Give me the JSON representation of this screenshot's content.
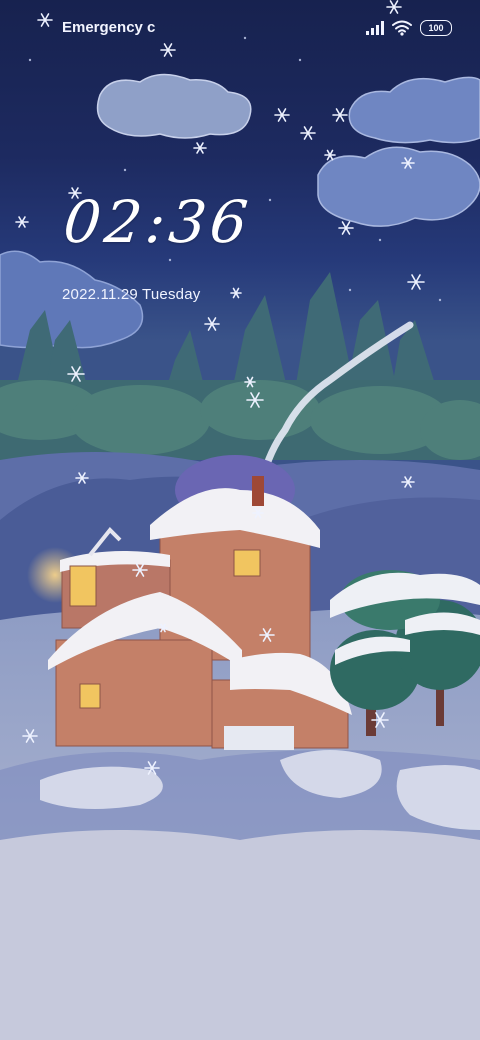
{
  "status_bar": {
    "carrier": "Emergency c",
    "battery": "100",
    "signal_icon": "signal-icon",
    "wifi_icon": "wifi-icon"
  },
  "lock_screen": {
    "time": "02:36",
    "date": "2022.11.29 Tuesday"
  },
  "wallpaper": {
    "theme": "snowy-cabin-night",
    "sky_color": "#1d2a60",
    "snow_color": "#e6e9f2",
    "window_light": "#f5c76a"
  }
}
